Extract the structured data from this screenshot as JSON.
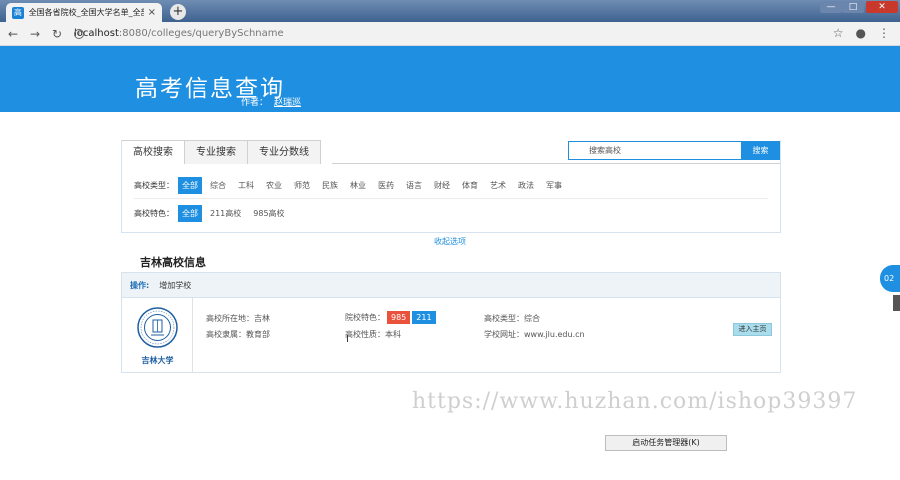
{
  "browser": {
    "tab_title": "全国各省院校_全国大学名单_全部",
    "tab_favicon": "高",
    "tab_close": "×",
    "newtab": "+",
    "url_host": "localhost",
    "url_path": ":8080/colleges/queryBySchname",
    "win_min": "—",
    "win_max": "□",
    "win_close": "✕",
    "back": "←",
    "forward": "→",
    "reload": "↻",
    "info": "i",
    "star": "☆",
    "account": "●",
    "menu": "⋮"
  },
  "header": {
    "title": "高考信息查询",
    "author_label": "作者：",
    "author_name": "赵瑞巡",
    "bg_color": "#1e8fe1"
  },
  "tabs": [
    "高校搜索",
    "专业搜索",
    "专业分数线"
  ],
  "search": {
    "placeholder": "搜索高校",
    "button": "搜索"
  },
  "filters": {
    "type_label": "高校类型：",
    "type_options": [
      "全部",
      "综合",
      "工科",
      "农业",
      "师范",
      "民族",
      "林业",
      "医药",
      "语言",
      "财经",
      "体育",
      "艺术",
      "政法",
      "军事"
    ],
    "type_selected": "全部",
    "feature_label": "高校特色：",
    "feature_options": [
      "全部",
      "211高校",
      "985高校"
    ],
    "feature_selected": "全部"
  },
  "collapse_label": "收起选项",
  "results": {
    "section_title": "吉林高校信息",
    "ops_label": "操作:",
    "ops_add": "增加学校",
    "university": {
      "name": "吉林大学",
      "location": "高校所在地：吉林",
      "affiliation": "高校隶属：教育部",
      "feature_label": "院校特色：",
      "badges": [
        "985",
        "211"
      ],
      "nature": "高校性质：本科",
      "type": "高校类型：综合",
      "website": "学校网址：www.jlu.edu.cn",
      "enter_button": "进入主页"
    }
  },
  "watermark": "https://www.huzhan.com/ishop39397",
  "taskmgr": "启动任务管理器(K)",
  "side_widget": "02",
  "cursor": "I"
}
